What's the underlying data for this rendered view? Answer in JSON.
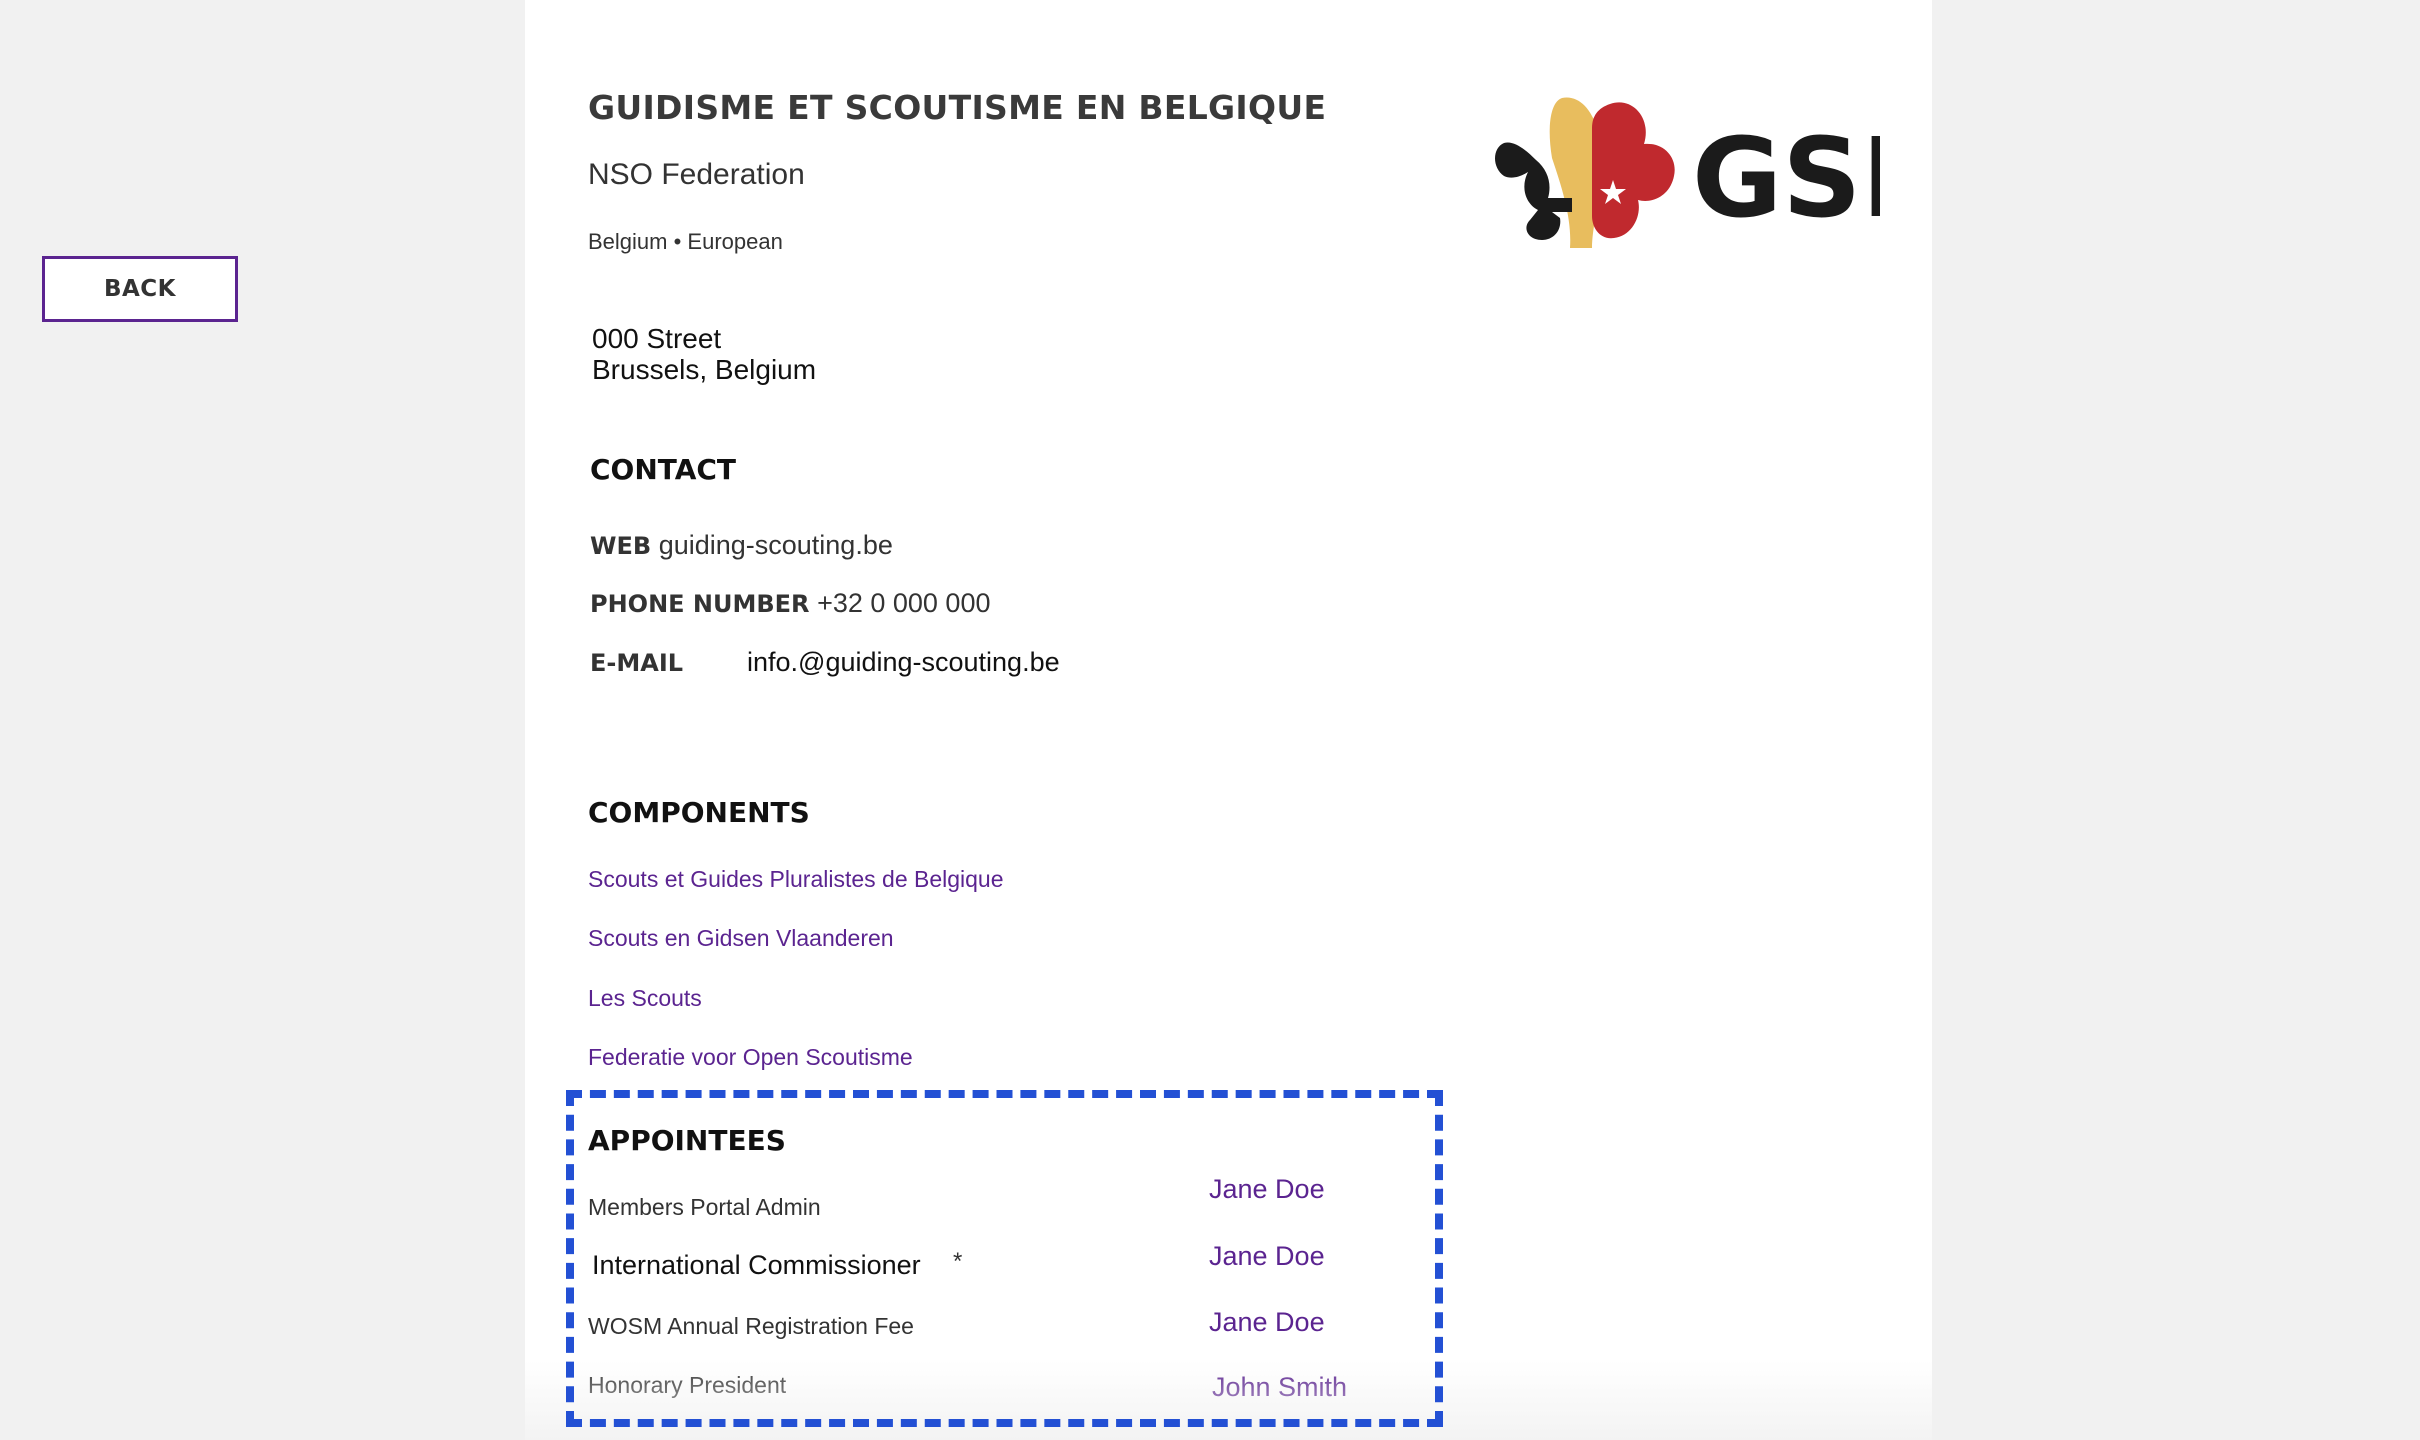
{
  "nav": {
    "back_label": "BACK"
  },
  "org": {
    "title": "GUIDISME ET SCOUTISME EN BELGIQUE",
    "subtitle": "NSO Federation",
    "region": "Belgium • European",
    "logo_text": "GSB"
  },
  "address": {
    "line1": "000 Street",
    "line2": "Brussels, Belgium"
  },
  "contact": {
    "heading": "CONTACT",
    "web_label": "WEB",
    "web_value": "guiding-scouting.be",
    "phone_label": "PHONE NUMBER",
    "phone_value": "+32 0 000 000",
    "email_label": "E-MAIL",
    "email_value": "info.@guiding-scouting.be"
  },
  "components": {
    "heading": "COMPONENTS",
    "items": [
      "Scouts et Guides Pluralistes de Belgique",
      "Scouts en Gidsen Vlaanderen",
      "Les Scouts",
      "Federatie voor Open Scoutisme"
    ]
  },
  "appointees": {
    "heading": "APPOINTEES",
    "rows": [
      {
        "role": "Members Portal Admin",
        "name": "Jane Doe"
      },
      {
        "role": "International Commissioner",
        "marker": "*",
        "name": "Jane Doe"
      },
      {
        "role": "WOSM Annual Registration Fee",
        "name": "Jane Doe"
      },
      {
        "role": "Honorary President",
        "name": "John Smith"
      }
    ]
  },
  "colors": {
    "background": "#f1f1f1",
    "card": "#ffffff",
    "accent_purple": "#5b2490",
    "highlight_blue": "#2350d4",
    "logo_yellow": "#e8bd5e",
    "logo_red": "#c0292e",
    "logo_black": "#1b1b1b"
  }
}
